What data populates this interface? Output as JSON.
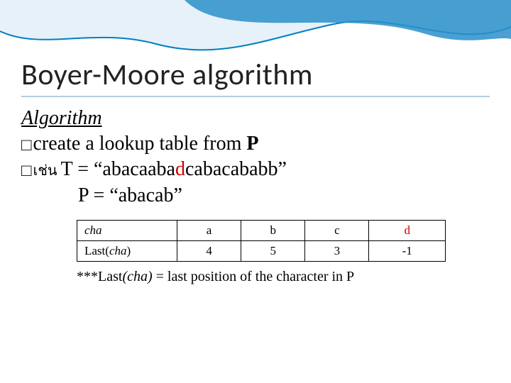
{
  "title": "Boyer-Moore algorithm",
  "subtitle": "Algorithm",
  "bullet_glyph": "□",
  "bullet1_text": "create a lookup table from ",
  "bullet1_bold": "P",
  "bullet2_prefix": "เช่น   ",
  "bullet2_T_pre": "T = “abacaaba",
  "bullet2_T_red": "d",
  "bullet2_T_post": "cabacababb”",
  "bullet3_P": "P = “abacab”",
  "table": {
    "rows": [
      {
        "label": "cha",
        "italic_label": true,
        "cells": [
          "a",
          "b",
          "c",
          "d"
        ],
        "d_red": true
      },
      {
        "label": "Last(cha)",
        "italic_label": true,
        "italic_paren": true,
        "cells": [
          "4",
          "5",
          "3",
          "-1"
        ],
        "d_red": false
      }
    ]
  },
  "foot_stars": "***",
  "foot_last": "Last",
  "foot_paren": "(cha)",
  "foot_rest": " = last position  of the character in P"
}
